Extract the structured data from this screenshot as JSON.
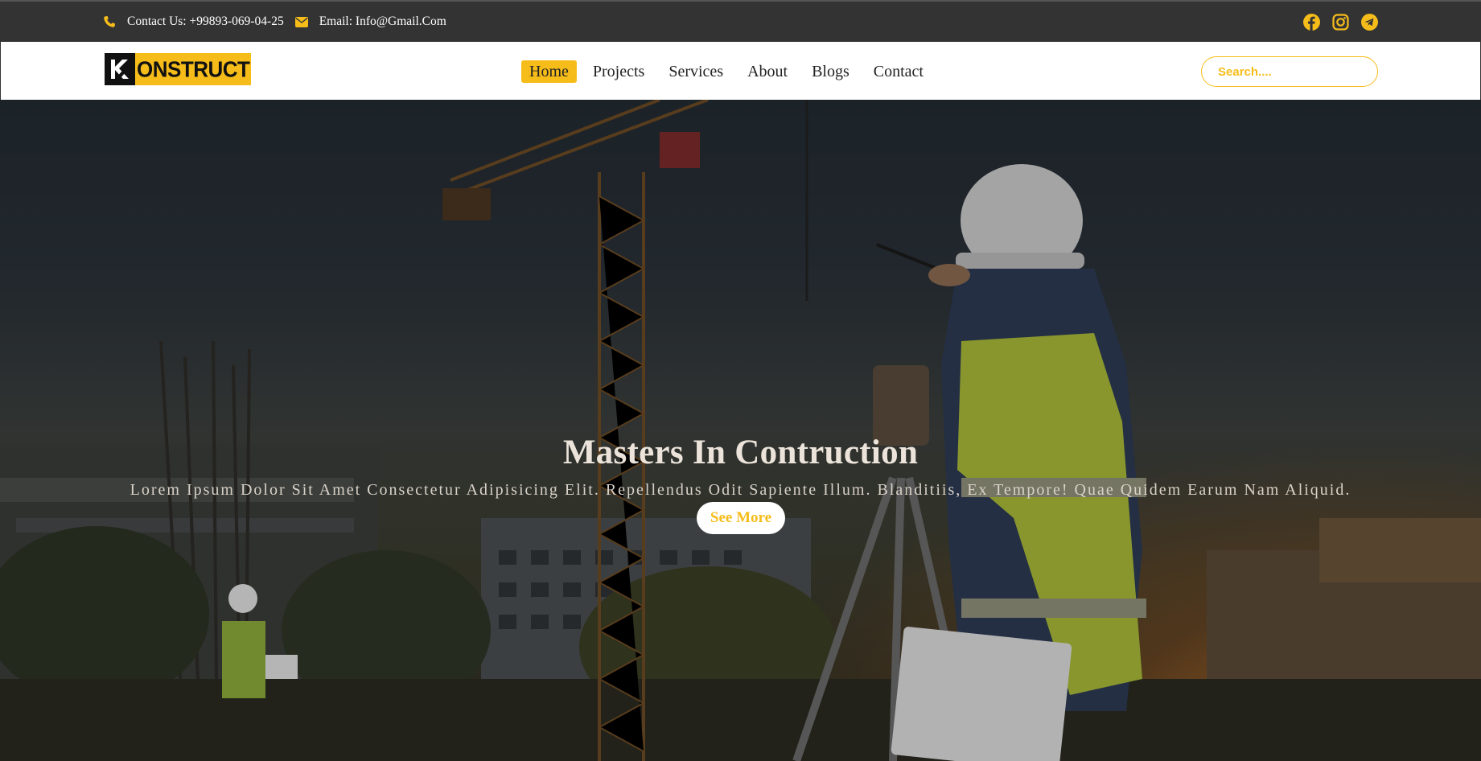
{
  "topbar": {
    "phone_label": "Contact Us: +99893-069-04-25",
    "email_label": "Email: Info@Gmail.Com",
    "phone_icon": "phone-icon",
    "email_icon": "envelope-icon",
    "socials": [
      "facebook-icon",
      "instagram-icon",
      "telegram-icon"
    ]
  },
  "navbar": {
    "logo_text": "ONSTRUCT",
    "links": [
      "Home",
      "Projects",
      "Services",
      "About",
      "Blogs",
      "Contact"
    ],
    "active_link": "Home",
    "search_placeholder": "Search...."
  },
  "hero": {
    "title": "Masters In Contruction",
    "subtitle": "Lorem Ipsum Dolor Sit Amet Consectetur Adipisicing Elit. Repellendus Odit Sapiente Illum. Blanditiis, Ex Tempore! Quae Quidem Earum Nam Aliquid.",
    "button_label": "See More"
  },
  "colors": {
    "accent": "#f6bd1a",
    "topbar_bg": "#333333",
    "nav_bg": "#ffffff"
  }
}
